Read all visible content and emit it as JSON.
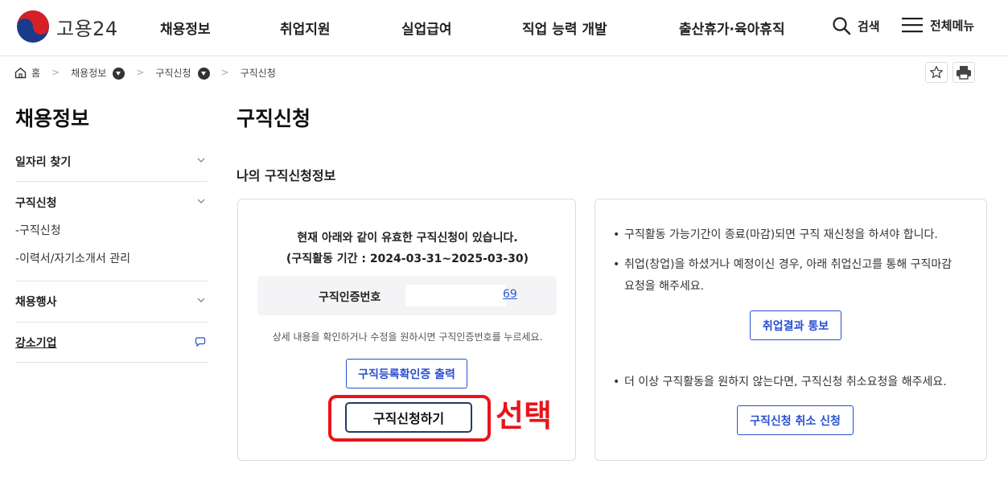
{
  "header": {
    "logo_text": "고용24",
    "nav": [
      "채용정보",
      "취업지원",
      "실업급여",
      "직업 능력 개발",
      "출산휴가·육아휴직"
    ],
    "search_label": "검색",
    "menu_label": "전체메뉴"
  },
  "breadcrumb": {
    "home": "홈",
    "level1": "채용정보",
    "level2": "구직신청",
    "current": "구직신청"
  },
  "sidebar": {
    "title": "채용정보",
    "items": [
      {
        "label": "일자리 찾기"
      },
      {
        "label": "구직신청"
      },
      {
        "label": "채용행사"
      },
      {
        "label": "강소기업"
      }
    ],
    "subitems": [
      "-구직신청",
      "-이력서/자기소개서 관리"
    ]
  },
  "main": {
    "title": "구직신청",
    "section_title": "나의 구직신청정보",
    "notice_line1": "현재 아래와 같이 유효한 구직신청이 있습니다.",
    "notice_line2": "(구직활동 기간 : 2024-03-31~2025-03-30)",
    "cert_label": "구직인증번호",
    "cert_number_suffix": "69",
    "help_text": "상세 내용을 확인하거나 수정을 원하시면 구직인증번호를 누르세요.",
    "print_button": "구직등록확인증 출력",
    "apply_button": "구직신청하기",
    "annotation_label": "선택"
  },
  "right_panel": {
    "bullet1": "구직활동 가능기간이 종료(마감)되면 구직 재신청을 하셔야 합니다.",
    "bullet2_line1": "취업(창업)을 하셨거나 예정이신 경우, 아래 취업신고를 통해 구직마감",
    "bullet2_line2": "요청을 해주세요.",
    "report_button": "취업결과 통보",
    "bullet3": "더 이상 구직활동을 원하지 않는다면, 구직신청 취소요청을 해주세요.",
    "cancel_button": "구직신청 취소 신청"
  },
  "colors": {
    "accent_blue": "#2a4fd0",
    "highlight_red": "#e8141b",
    "dark_button_border": "#253b64"
  }
}
